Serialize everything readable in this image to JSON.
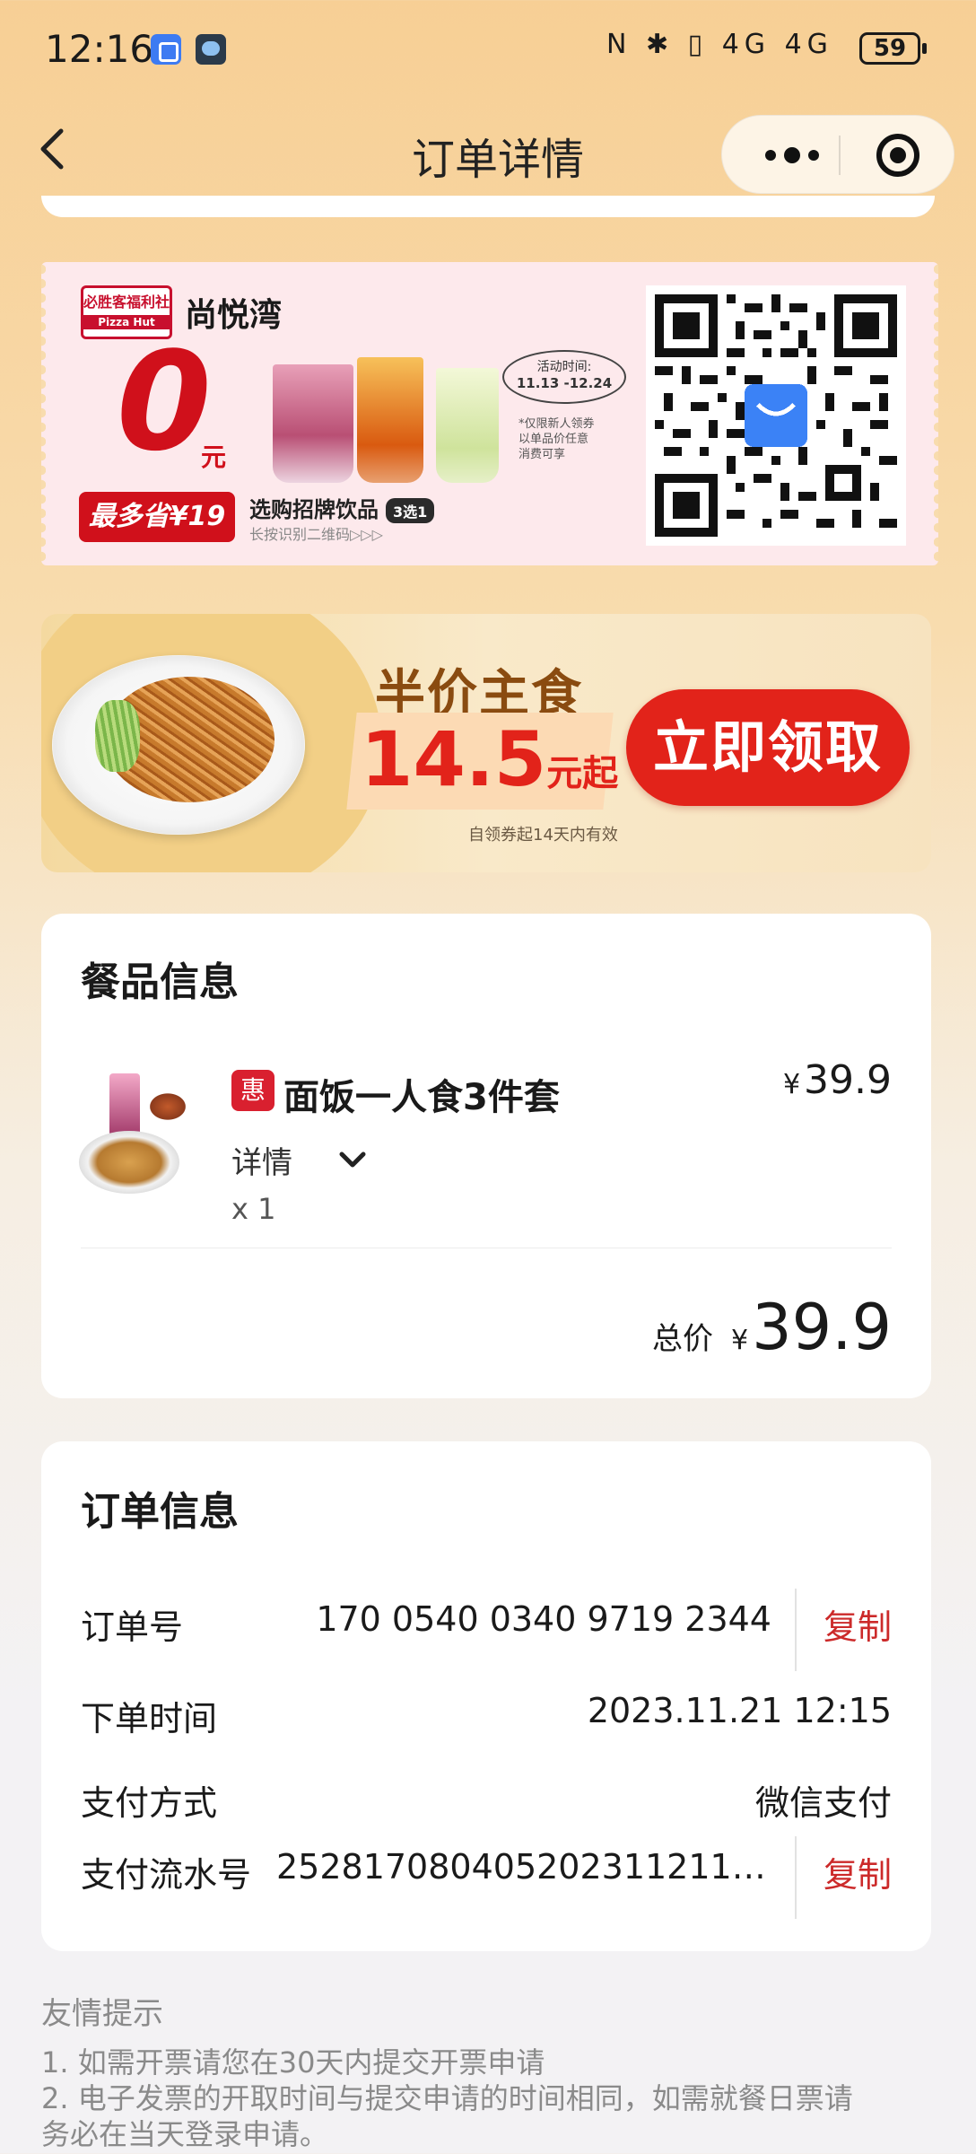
{
  "status_bar": {
    "time": "12:16",
    "icons": "N ✱ ▯ 4G 4G",
    "battery": "59"
  },
  "nav": {
    "title": "订单详情"
  },
  "coupon": {
    "brand_logo": "必胜客福利社",
    "brand_sub": "Pizza Hut",
    "store_name": "尚悦湾",
    "zero": "0",
    "yuan": "元",
    "save_text": "最多省¥19",
    "drink_label": "选购招牌饮品",
    "three_pick": "3选1",
    "scan_hint": "长按识别二维码▷▷▷",
    "activity_label": "活动时间:",
    "activity_dates": "11.13 -12.24",
    "note_1": "*仅限新人领券",
    "note_2": "以单品价任意",
    "note_3": "消费可享"
  },
  "promo": {
    "title": "半价主食",
    "price": "14.5",
    "price_unit": "元起",
    "valid": "自领券起14天内有效",
    "cta": "立即领取"
  },
  "food": {
    "title": "餐品信息",
    "badge": "惠",
    "item_name": "面饭一人食3件套",
    "currency": "¥",
    "item_price": "39.9",
    "detail": "详情",
    "qty": "x 1",
    "total_label": "总价",
    "total_value": "39.9"
  },
  "order": {
    "title": "订单信息",
    "order_no_label": "订单号",
    "order_no": "170 0540 0340 9719 2344",
    "copy": "复制",
    "time_label": "下单时间",
    "time_value": "2023.11.21 12:15",
    "pay_method_label": "支付方式",
    "pay_method": "微信支付",
    "serial_label": "支付流水号",
    "serial_value": "2528170804052023112117…"
  },
  "tips": {
    "title": "友情提示",
    "line1": "1. 如需开票请您在30天内提交开票申请",
    "line2": "2. 电子发票的开取时间与提交申请的时间相同，如需就餐日票请",
    "line3": "务必在当天登录申请。"
  },
  "colors": {
    "accent_red": "#e2231a",
    "copy_red": "#cc2a2a",
    "bg_top": "#f7cf95"
  }
}
